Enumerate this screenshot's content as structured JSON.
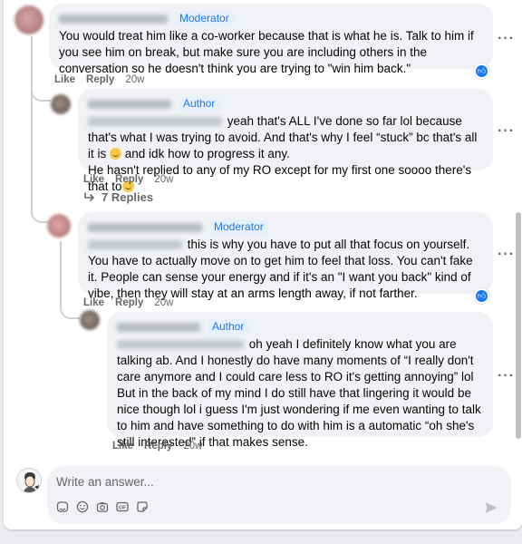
{
  "comments": [
    {
      "badge": "Moderator",
      "text": "You would treat him like a co-worker because that is what he is. Talk to him if you see him on break, but make sure you are including others in the conversation so he doesn't think you are trying to \"win him back.\"",
      "like": "Like",
      "reply": "Reply",
      "time": "20w"
    },
    {
      "badge": "Author",
      "text_a": "yeah that's ALL I've done so far lol because that's what I was trying to avoid. And that's why I feel “stuck” bc that's all it is",
      "text_b": "and idk how to progress it any.",
      "text_c": "He hasn't replied to any of my RO except for my first one soooo there's that to",
      "like": "Like",
      "reply": "Reply",
      "time": "20w",
      "replies": "7 Replies"
    },
    {
      "badge": "Moderator",
      "text_a": "this is why you have to put all that focus on yourself. You have to actually move on to get him to feel that loss. You can't fake it. People can sense your energy and if it's an \"I want you back\" kind of vibe, then they will stay at an arms length away, if not farther.",
      "like": "Like",
      "reply": "Reply",
      "time": "20w"
    },
    {
      "badge": "Author",
      "text_a": "oh yeah I definitely know what you are talking ab. And I honestly do have many moments of “I really don't care anymore and I could care less to RO it's getting annoying” lol",
      "text_b": "But in the back of my mind I do still have that lingering it would be nice though lol i guess I'm just wondering if me even wanting to talk to him and have something to do with him is a automatic “oh she's still interested” if that makes sense.",
      "like": "Like",
      "reply": "Reply",
      "time": "20w"
    }
  ],
  "composer": {
    "placeholder": "Write an answer..."
  },
  "icons": {
    "more": "more-options-icon",
    "like_reaction": "thumbs-up-icon",
    "reply_arrow": "reply-arrow-icon",
    "composer": [
      "sticker-icon",
      "emoji-icon",
      "camera-icon",
      "gif-icon",
      "avatar-sticker-icon"
    ],
    "send": "send-icon"
  },
  "colors": {
    "accent": "#1877f2",
    "bubble": "#f0f2f5",
    "muted": "#65676b"
  }
}
